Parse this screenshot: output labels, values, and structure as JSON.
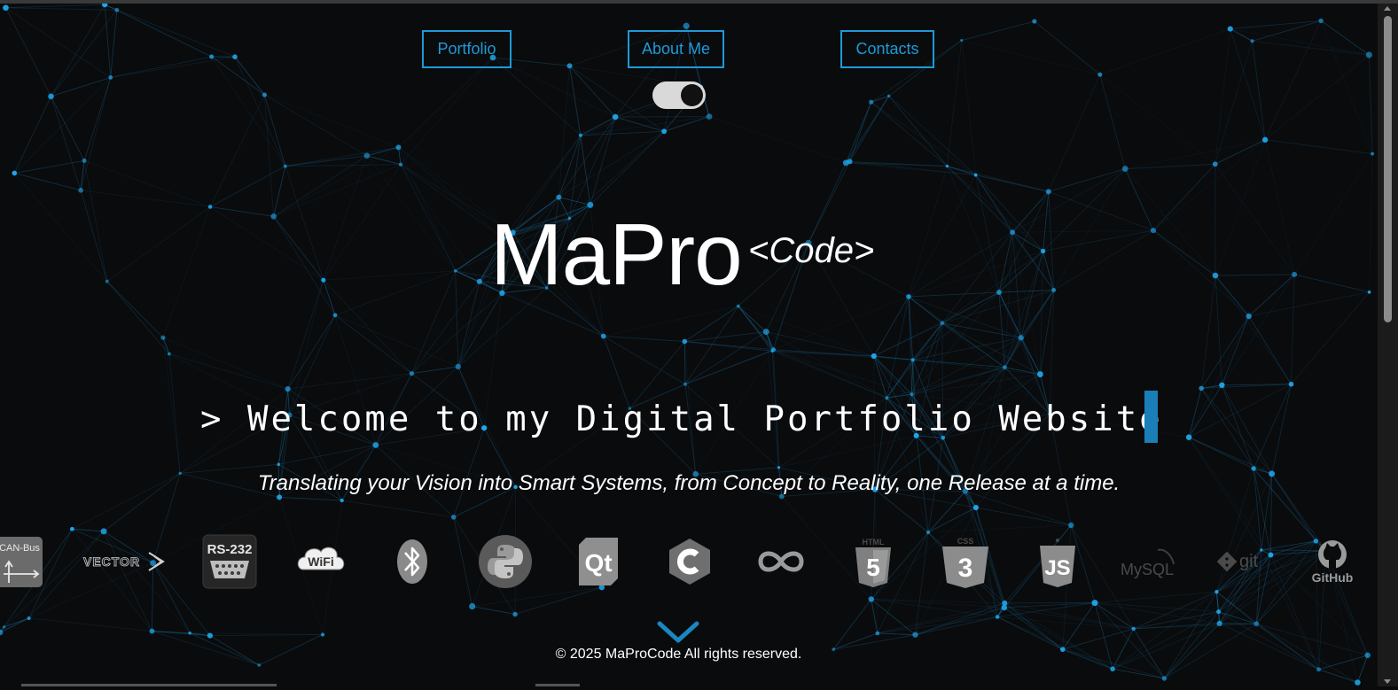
{
  "nav": {
    "portfolio_label": "Portfolio",
    "about_label": "About Me",
    "contacts_label": "Contacts"
  },
  "theme_toggle": {
    "icon": "dark-mode-toggle",
    "state": "dark"
  },
  "hero": {
    "logo_main": "MaPro",
    "logo_sup": "<Code>",
    "welcome_text": "> Welcome to my Digital Portfolio Website",
    "tagline": "Translating your Vision into Smart Systems, from Concept to Reality, one Release at a time."
  },
  "tech_logos": {
    "can_bus": "CAN-Bus",
    "vector": "VECTOR",
    "rs232": "RS-232",
    "wifi": "WiFi",
    "bluetooth": "bluetooth-icon",
    "python": "python-icon",
    "qt": "Qt",
    "c": "c-language-icon",
    "arduino": "arduino-icon",
    "html5": "HTML",
    "html5_num": "5",
    "css3": "CSS",
    "css3_num": "3",
    "js": "JS",
    "mysql": "MySQL",
    "git": "git",
    "github": "GitHub"
  },
  "scroll_indicator": {
    "icon": "chevron-down-icon"
  },
  "footer": {
    "text": "© 2025 MaProCode All rights reserved."
  },
  "colors": {
    "accent": "#1e9ad6",
    "background": "#0a0b0d",
    "cursor": "#1a7fb7",
    "network_node": "#1fa8ee",
    "network_line": "#1a6f9c"
  }
}
